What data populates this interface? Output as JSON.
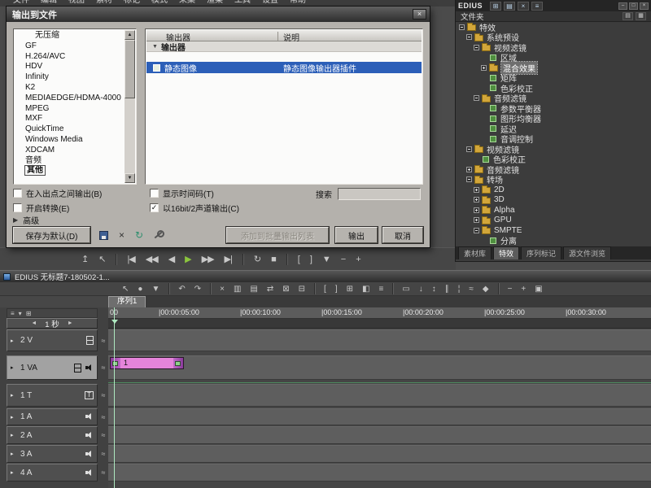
{
  "icons": {
    "close": "×",
    "checkmark": "✓",
    "scroll_up": "▲",
    "scroll_down": "▼",
    "group_collapse": "▼",
    "advanced_arrow": "▶",
    "expander": "▸",
    "scale_left": "◄",
    "scale_right": "►",
    "title_track": "T"
  },
  "menu_bar": {
    "items": [
      "文件",
      "编辑",
      "视图",
      "素材",
      "标记",
      "模式",
      "采集",
      "渲染",
      "工具",
      "设置",
      "帮助"
    ]
  },
  "transport_bar": {
    "icons": [
      {
        "name": "capture-icon",
        "glyph": "↥"
      },
      {
        "name": "mouse-mode-icon",
        "glyph": "↖"
      },
      {
        "sep": true
      },
      {
        "name": "prev-edit-icon",
        "glyph": "|◀"
      },
      {
        "name": "rewind-icon",
        "glyph": "◀◀"
      },
      {
        "name": "frame-back-icon",
        "glyph": "◀"
      },
      {
        "name": "play-icon",
        "glyph": "▶",
        "color": "#8cc63e"
      },
      {
        "name": "fast-forward-icon",
        "glyph": "▶▶"
      },
      {
        "name": "next-edit-icon",
        "glyph": "▶|"
      },
      {
        "sep": true
      },
      {
        "name": "loop-icon",
        "glyph": "↻"
      },
      {
        "name": "stop-icon",
        "glyph": "■"
      },
      {
        "sep": true
      },
      {
        "name": "set-in-icon",
        "glyph": "["
      },
      {
        "name": "set-out-icon",
        "glyph": "]"
      },
      {
        "name": "add-marker-icon",
        "glyph": "▼"
      },
      {
        "name": "zoom-out-icon",
        "glyph": "−"
      },
      {
        "name": "zoom-in-icon",
        "glyph": "+"
      }
    ]
  },
  "export_dialog": {
    "title": "输出到文件",
    "formats": [
      {
        "label": "无压缩",
        "indent": 1
      },
      {
        "label": "GF"
      },
      {
        "label": "H.264/AVC"
      },
      {
        "label": "HDV"
      },
      {
        "label": "Infinity"
      },
      {
        "label": "K2"
      },
      {
        "label": "MEDIAEDGE/HDMA-4000"
      },
      {
        "label": "MPEG"
      },
      {
        "label": "MXF"
      },
      {
        "label": "QuickTime"
      },
      {
        "label": "Windows Media"
      },
      {
        "label": "XDCAM"
      },
      {
        "label": "音频"
      },
      {
        "label": "其他",
        "selected": true
      }
    ],
    "exporter_table": {
      "columns": [
        "输出器",
        "说明"
      ],
      "group_header": "输出器",
      "rows": [
        {
          "name": "静态图像",
          "description": "静态图像输出器插件",
          "selected": true
        }
      ]
    },
    "options": [
      {
        "name": "output-between-inout-checkbox",
        "label": "在入出点之间输出(B)",
        "checked": false
      },
      {
        "name": "show-timecode-checkbox",
        "label": "显示时间码(T)",
        "checked": false
      },
      {
        "name": "enable-conversion-checkbox",
        "label": "开启转换(E)",
        "checked": false
      },
      {
        "name": "16bit-2ch-output-checkbox",
        "label": "以16bit/2声道输出(C)",
        "checked": true
      }
    ],
    "search_label": "搜索",
    "search_value": "",
    "advanced_label": "高级",
    "tool_icons": [
      {
        "name": "save-preset-icon",
        "type": "disk"
      },
      {
        "name": "delete-preset-icon",
        "glyph": "×"
      },
      {
        "name": "refresh-preset-icon",
        "glyph": "↻",
        "color": "#2e8f6e"
      },
      {
        "name": "preset-tools-icon",
        "type": "wrench"
      }
    ],
    "buttons": {
      "save_default": "保存为默认(D)",
      "add_to_batch": "添加到批量输出列表",
      "output": "输出",
      "cancel": "取消"
    }
  },
  "effects_panel": {
    "title": "EDIUS",
    "header_icons": [
      {
        "name": "add-to-timeline-icon",
        "glyph": "⊞"
      },
      {
        "name": "new-folder-icon",
        "glyph": "▤"
      },
      {
        "name": "delete-icon",
        "glyph": "×"
      },
      {
        "name": "properties-icon",
        "glyph": "≡"
      }
    ],
    "window_buttons": [
      {
        "name": "minimize-button",
        "glyph": "–"
      },
      {
        "name": "maximize-button",
        "glyph": "□"
      },
      {
        "name": "close-button",
        "glyph": "×"
      }
    ],
    "folder_bar": {
      "label": "文件夹",
      "icons": [
        {
          "name": "list-view-icon",
          "glyph": "▤"
        },
        {
          "name": "icon-view-icon",
          "glyph": "▦"
        }
      ]
    },
    "tree": [
      {
        "label": "特效",
        "depth": 0,
        "icon": "folder",
        "expanded": true
      },
      {
        "label": "系统预设",
        "depth": 1,
        "icon": "folder",
        "expanded": true
      },
      {
        "label": "视频滤镜",
        "depth": 2,
        "icon": "folder",
        "expanded": true
      },
      {
        "label": "区域",
        "depth": 3,
        "icon": "effect"
      },
      {
        "label": "混合效果",
        "depth": 3,
        "icon": "folder",
        "selected": true
      },
      {
        "label": "矩阵",
        "depth": 3,
        "icon": "effect"
      },
      {
        "label": "色彩校正",
        "depth": 3,
        "icon": "effect"
      },
      {
        "label": "音频滤镜",
        "depth": 2,
        "icon": "folder",
        "expanded": true
      },
      {
        "label": "参数平衡器",
        "depth": 3,
        "icon": "effect"
      },
      {
        "label": "图形均衡器",
        "depth": 3,
        "icon": "effect"
      },
      {
        "label": "延迟",
        "depth": 3,
        "icon": "effect"
      },
      {
        "label": "音调控制",
        "depth": 3,
        "icon": "effect"
      },
      {
        "label": "视频滤镜",
        "depth": 1,
        "icon": "folder",
        "expanded": true
      },
      {
        "label": "色彩校正",
        "depth": 2,
        "icon": "effect"
      },
      {
        "label": "音频滤镜",
        "depth": 1,
        "icon": "folder"
      },
      {
        "label": "转场",
        "depth": 1,
        "icon": "folder",
        "expanded": true
      },
      {
        "label": "2D",
        "depth": 2,
        "icon": "folder"
      },
      {
        "label": "3D",
        "depth": 2,
        "icon": "folder"
      },
      {
        "label": "Alpha",
        "depth": 2,
        "icon": "folder"
      },
      {
        "label": "GPU",
        "depth": 2,
        "icon": "folder"
      },
      {
        "label": "SMPTE",
        "depth": 2,
        "icon": "folder",
        "expanded": true
      },
      {
        "label": "分离",
        "depth": 3,
        "icon": "effect"
      }
    ],
    "tabs": [
      {
        "label": "素材库"
      },
      {
        "label": "特效",
        "active": true
      },
      {
        "label": "序列标记"
      },
      {
        "label": "源文件浏览"
      }
    ]
  },
  "timeline": {
    "window_title": "EDIUS 无标题7-180502-1...",
    "sequence_tab": "序列1",
    "time_scale": "1 秒",
    "track_header": {
      "icons": [
        {
          "name": "track-menu-icon",
          "glyph": "≡"
        },
        {
          "name": "track-lock-icon",
          "glyph": "▾"
        },
        {
          "name": "track-height-icon",
          "glyph": "⊞"
        }
      ]
    },
    "toolbar_icons": [
      {
        "name": "pointer-icon",
        "glyph": "↖"
      },
      {
        "name": "capture-icon",
        "glyph": "●"
      },
      {
        "name": "save-icon",
        "glyph": "▼"
      },
      {
        "sep": true
      },
      {
        "name": "undo-icon",
        "glyph": "↶"
      },
      {
        "name": "redo-icon",
        "glyph": "↷"
      },
      {
        "sep": true
      },
      {
        "name": "cut-icon",
        "glyph": "×"
      },
      {
        "name": "copy-icon",
        "glyph": "▥"
      },
      {
        "name": "paste-icon",
        "glyph": "▤"
      },
      {
        "name": "replace-icon",
        "glyph": "⇄"
      },
      {
        "name": "delete-icon",
        "glyph": "⊠"
      },
      {
        "name": "ripple-delete-icon",
        "glyph": "⊟"
      },
      {
        "sep": true
      },
      {
        "name": "set-in-icon",
        "glyph": "["
      },
      {
        "name": "set-out-icon",
        "glyph": "]"
      },
      {
        "name": "add-clip-icon",
        "glyph": "⊞"
      },
      {
        "name": "add-transition-icon",
        "glyph": "◧"
      },
      {
        "name": "audio-mixer-icon",
        "glyph": "≡"
      },
      {
        "sep": true
      },
      {
        "name": "normal-mode-icon",
        "glyph": "▭"
      },
      {
        "name": "insert-mode-icon",
        "glyph": "↓"
      },
      {
        "name": "overwrite-mode-icon",
        "glyph": "↕"
      },
      {
        "name": "sync-lock-icon",
        "glyph": "∥"
      },
      {
        "name": "snap-icon",
        "glyph": "¦"
      },
      {
        "name": "waveform-icon",
        "glyph": "≈"
      },
      {
        "name": "add-marker-icon",
        "glyph": "◆"
      },
      {
        "sep": true
      },
      {
        "name": "zoom-out-icon",
        "glyph": "−"
      },
      {
        "name": "zoom-in-icon",
        "glyph": "+"
      },
      {
        "name": "settings-icon",
        "glyph": "▣"
      }
    ],
    "ruler": {
      "clipped_label": "00",
      "ticks": [
        "00:00:05:00",
        "00:00:10:00",
        "00:00:15:00",
        "00:00:20:00",
        "00:00:25:00",
        "00:00:30:00"
      ]
    },
    "tracks": [
      {
        "label": "2 V",
        "type": "video",
        "icons": [
          "film"
        ]
      },
      {
        "label": "1 VA",
        "type": "va",
        "active": true,
        "icons": [
          "film",
          "speaker"
        ]
      },
      {
        "label": "1 T",
        "type": "title",
        "icons": [
          "title"
        ]
      },
      {
        "label": "1 A",
        "type": "audio",
        "icons": [
          "speaker"
        ]
      },
      {
        "label": "2 A",
        "type": "audio",
        "icons": [
          "speaker"
        ]
      },
      {
        "label": "3 A",
        "type": "audio",
        "icons": [
          "speaker"
        ]
      },
      {
        "label": "4 A",
        "type": "audio",
        "icons": [
          "speaker"
        ]
      }
    ],
    "clip": {
      "label": "1",
      "color": "#e584da"
    }
  }
}
